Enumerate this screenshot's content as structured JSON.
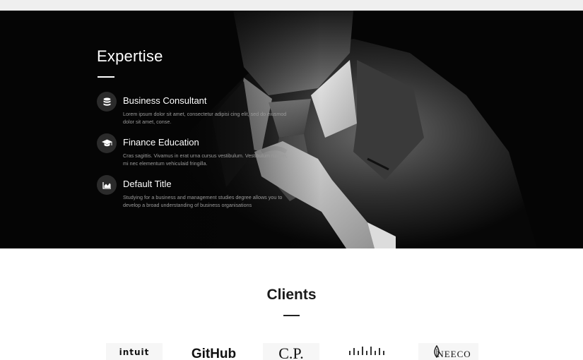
{
  "expertise": {
    "title": "Expertise",
    "items": [
      {
        "icon": "database-icon",
        "title": "Business Consultant",
        "description": "Lorem ipsum dolor sit amet, consectetur adipisi cing elit, sed do eiusmod dolor sit amet, conse."
      },
      {
        "icon": "graduation-cap-icon",
        "title": "Finance Education",
        "description": "Cras sagittis. Vivamus in erat urna cursus vestibulum. Vestibulum rutrum, mi nec elementum vehiculaid fringilla."
      },
      {
        "icon": "area-chart-icon",
        "title": "Default Title",
        "description": "Studying for a business and management studies degree allows you to develop a broad understanding of business organisations"
      }
    ]
  },
  "clients": {
    "title": "Clients",
    "logos": [
      "intuit",
      "GitHub",
      "C.P.",
      "cisco",
      "NEECO"
    ]
  },
  "colors": {
    "hero_background": "#050505",
    "icon_circle": "#2b2b2b",
    "text_light": "#ffffff",
    "text_muted": "#9a9a9a"
  }
}
